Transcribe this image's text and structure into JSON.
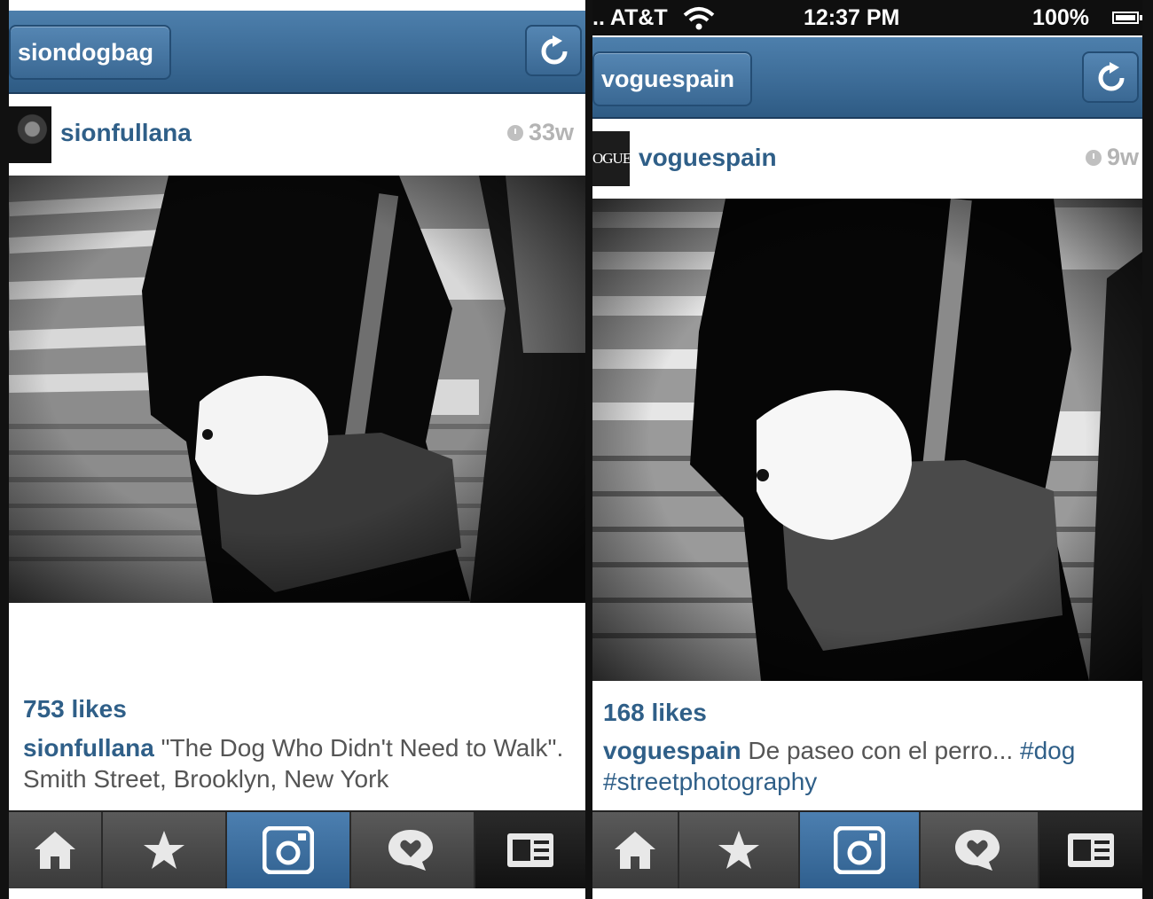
{
  "left": {
    "nav_title": "siondogbag",
    "post": {
      "username": "sionfullana",
      "time_ago": "33w",
      "likes": "753 likes",
      "caption_user": "sionfullana",
      "caption_text": " \"The Dog Who Didn't Need to Walk\". Smith Street, Brooklyn, New York"
    }
  },
  "right": {
    "status": {
      "carrier": ".. AT&T",
      "time": "12:37 PM",
      "battery": "100%"
    },
    "nav_title": "voguespain",
    "post": {
      "username": "voguespain",
      "avatar_text": "OGUE",
      "time_ago": "9w",
      "likes": "168 likes",
      "caption_user": "voguespain",
      "caption_text": " De paseo con el perro... ",
      "hashtag_1": "#dog",
      "hashtag_2": "#streetphotography"
    }
  },
  "tabs": [
    {
      "icon": "home-icon"
    },
    {
      "icon": "star-icon"
    },
    {
      "icon": "camera-icon",
      "active": true
    },
    {
      "icon": "heart-speech-icon"
    },
    {
      "icon": "profile-card-icon"
    }
  ],
  "colors": {
    "nav_blue": "#3b6a95",
    "link_blue": "#2f5f88",
    "tab_active": "#3e70a0"
  }
}
